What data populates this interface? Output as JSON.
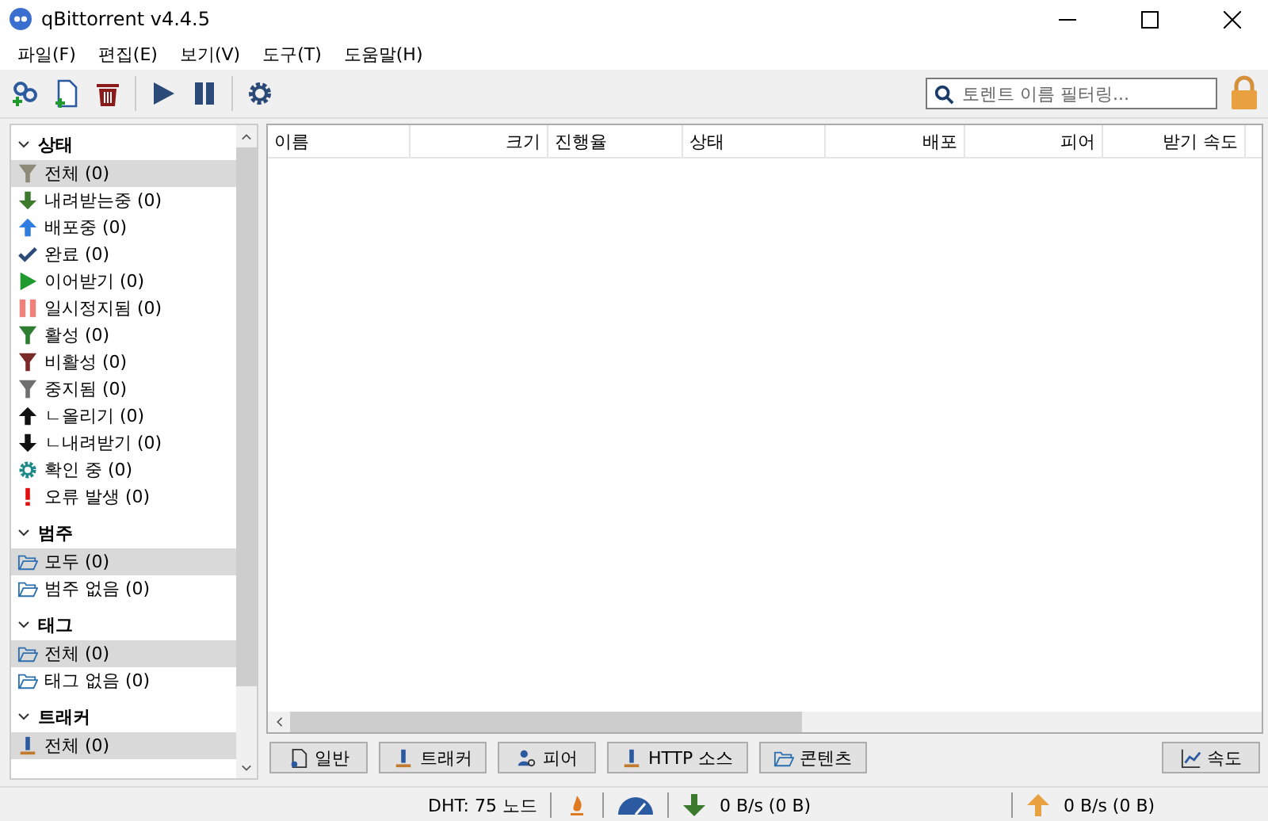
{
  "window": {
    "title": "qBittorrent v4.4.5"
  },
  "menu": [
    "파일(F)",
    "편집(E)",
    "보기(V)",
    "도구(T)",
    "도움말(H)"
  ],
  "search": {
    "placeholder": "토렌트 이름 필터링..."
  },
  "sidebar": [
    {
      "title": "상태",
      "expanded": true,
      "items": [
        {
          "kind": "all",
          "label": "전체 (0)",
          "selected": true
        },
        {
          "kind": "downloading",
          "label": "내려받는중 (0)",
          "selected": false
        },
        {
          "kind": "seeding",
          "label": "배포중 (0)",
          "selected": false
        },
        {
          "kind": "completed",
          "label": "완료 (0)",
          "selected": false
        },
        {
          "kind": "resumed",
          "label": "이어받기 (0)",
          "selected": false
        },
        {
          "kind": "paused",
          "label": "일시정지됨 (0)",
          "selected": false
        },
        {
          "kind": "active",
          "label": "활성 (0)",
          "selected": false
        },
        {
          "kind": "inactive",
          "label": "비활성 (0)",
          "selected": false
        },
        {
          "kind": "stalled",
          "label": "중지됨 (0)",
          "selected": false
        },
        {
          "kind": "stalled-up",
          "label": "ㄴ올리기 (0)",
          "selected": false
        },
        {
          "kind": "stalled-down",
          "label": "ㄴ내려받기 (0)",
          "selected": false
        },
        {
          "kind": "checking",
          "label": "확인 중 (0)",
          "selected": false
        },
        {
          "kind": "errored",
          "label": "오류 발생 (0)",
          "selected": false
        }
      ]
    },
    {
      "title": "범주",
      "expanded": true,
      "items": [
        {
          "kind": "folder",
          "label": "모두 (0)",
          "selected": true
        },
        {
          "kind": "folder",
          "label": "범주 없음 (0)",
          "selected": false
        }
      ]
    },
    {
      "title": "태그",
      "expanded": true,
      "items": [
        {
          "kind": "folder",
          "label": "전체 (0)",
          "selected": true
        },
        {
          "kind": "folder",
          "label": "태그 없음 (0)",
          "selected": false
        }
      ]
    },
    {
      "title": "트래커",
      "expanded": true,
      "items": [
        {
          "kind": "tracker",
          "label": "전체 (0)",
          "selected": true
        }
      ]
    }
  ],
  "table": {
    "columns": [
      {
        "label": "이름"
      },
      {
        "label": "크기"
      },
      {
        "label": "진행율"
      },
      {
        "label": "상태"
      },
      {
        "label": "배포"
      },
      {
        "label": "피어"
      },
      {
        "label": "받기 속도"
      }
    ]
  },
  "detail_tabs": [
    {
      "kind": "general",
      "label": "일반"
    },
    {
      "kind": "tracker",
      "label": "트래커"
    },
    {
      "kind": "peers",
      "label": "피어"
    },
    {
      "kind": "http",
      "label": "HTTP 소스"
    },
    {
      "kind": "content",
      "label": "콘텐츠"
    }
  ],
  "speed_button": {
    "label": "속도"
  },
  "status_bar": {
    "dht": "DHT: 75 노드",
    "download": "0 B/s (0 B)",
    "upload": "0 B/s (0 B)"
  }
}
